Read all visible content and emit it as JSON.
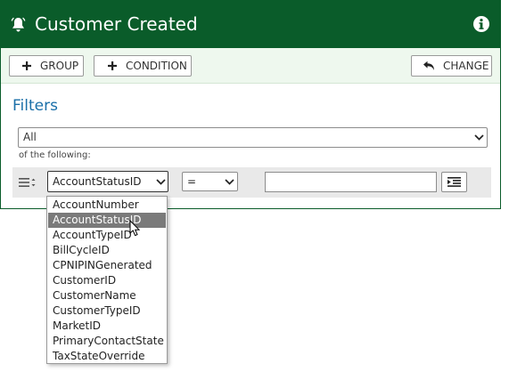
{
  "header": {
    "title": "Customer Created",
    "bell_icon": "bell-icon",
    "info_icon": "info-icon",
    "background_color": "#0a5c2a"
  },
  "toolbar": {
    "group_label": "GROUP",
    "condition_label": "CONDITION",
    "change_label": "CHANGE"
  },
  "filters": {
    "heading": "Filters",
    "match_select_value": "All",
    "match_caption": "of the following:",
    "row": {
      "field_value": "AccountStatusID",
      "operator_value": "=",
      "input_value": ""
    }
  },
  "dropdown": {
    "selected_index": 1,
    "options": [
      "AccountNumber",
      "AccountStatusID",
      "AccountTypeID",
      "BillCycleID",
      "CPNIPINGenerated",
      "CustomerID",
      "CustomerName",
      "CustomerTypeID",
      "MarketID",
      "PrimaryContactState",
      "TaxStateOverride"
    ]
  }
}
